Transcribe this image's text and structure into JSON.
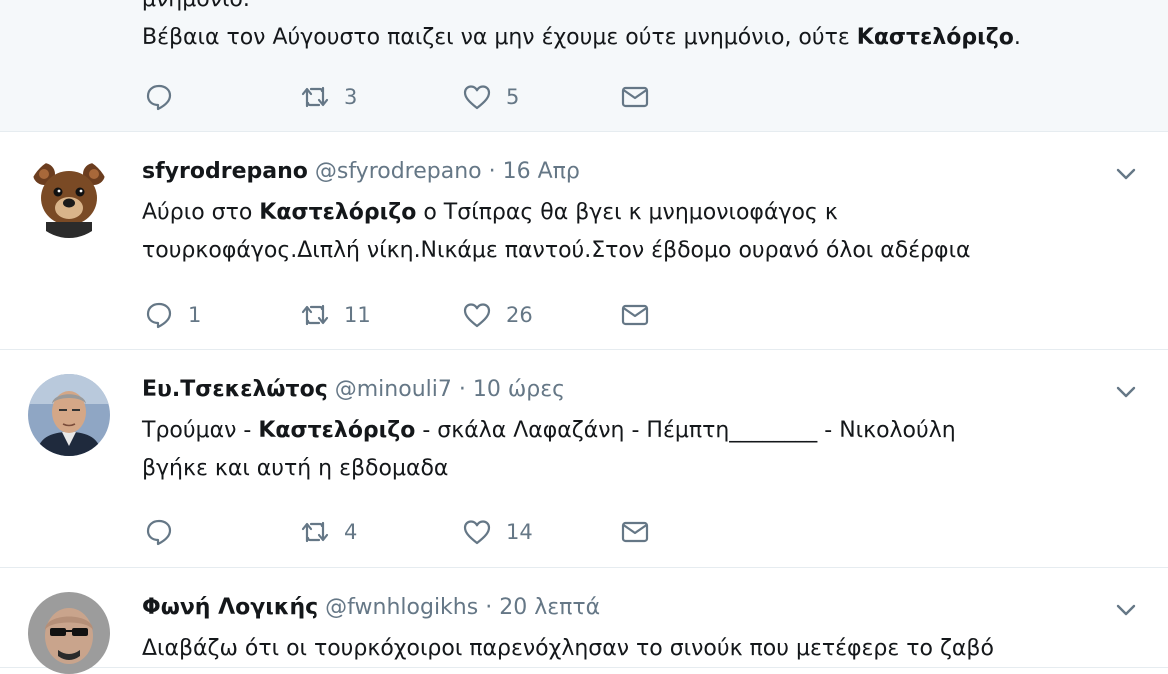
{
  "tweets": [
    {
      "partial_line": "μνημόνιο.",
      "text_before": "Βέβαια τον Αύγουστο παιζει να μην έχουμε ούτε μνημόνιο, ούτε ",
      "highlight": "Καστελόριζο",
      "text_after": ".",
      "reply_count": "",
      "retweet_count": "3",
      "like_count": "5"
    },
    {
      "name": "sfyrodrepano",
      "handle": "@sfyrodrepano",
      "time": "16 Απρ",
      "line1_before": "Αύριο στο ",
      "highlight": "Καστελόριζο",
      "line1_after": " ο Τσίπρας θα βγει κ μνημονιοφάγος κ",
      "line2": "τουρκοφάγος.Διπλή νίκη.Νικάμε παντού.Στον έβδομο ουρανό όλοι αδέρφια",
      "reply_count": "1",
      "retweet_count": "11",
      "like_count": "26"
    },
    {
      "name": "Ευ.Τσεκελώτος",
      "handle": "@minouli7",
      "time": "10 ώρες",
      "line1_before": "Τρούμαν - ",
      "highlight": "Καστελόριζο",
      "line1_after": " - σκάλα Λαφαζάνη - Πέμπτη________ - Νικολούλη",
      "line2": "βγήκε και αυτή η εβδομαδα",
      "reply_count": "",
      "retweet_count": "4",
      "like_count": "14"
    },
    {
      "name": "Φωνή Λογικής",
      "handle": "@fwnhlogikhs",
      "time": "20 λεπτά",
      "line1": "Διαβάζω ότι οι τουρκόχοιροι παρενόχλησαν το σινούκ που μετέφερε το ζαβό"
    }
  ],
  "separator": "·",
  "colors": {
    "muted": "#657786",
    "divider": "#e6ecf0",
    "highlight_bg": "#f5f8fa"
  }
}
